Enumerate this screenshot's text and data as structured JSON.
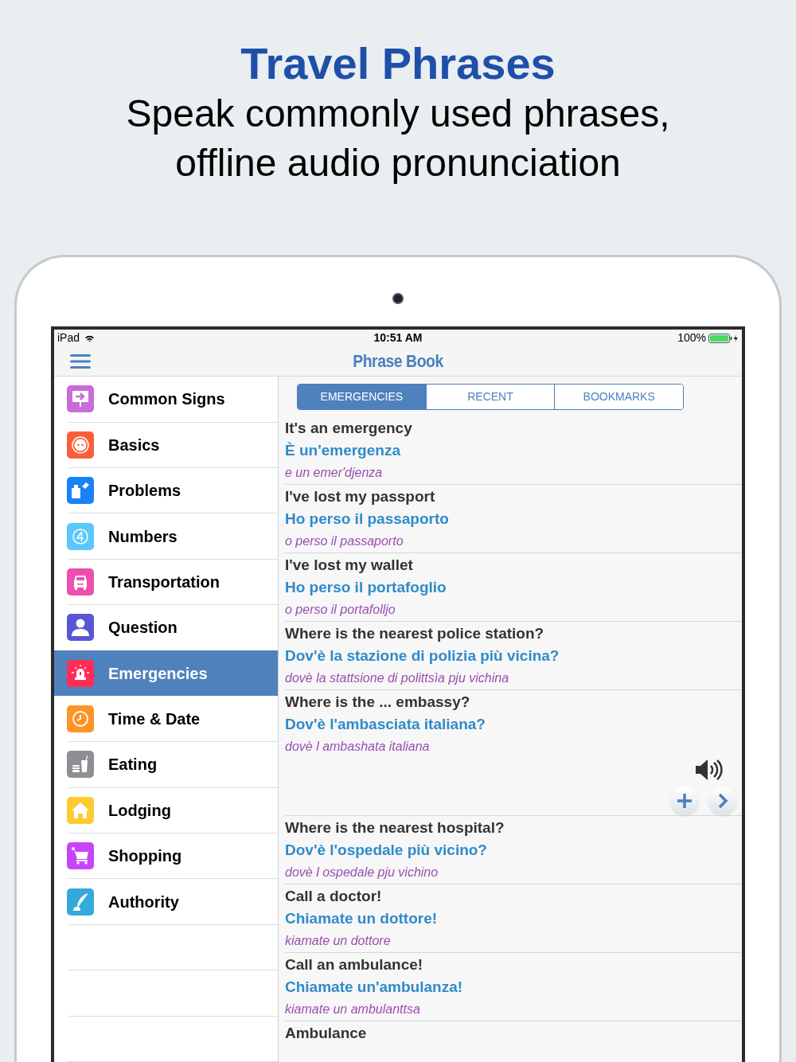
{
  "headline": {
    "title": "Travel Phrases",
    "subtitle": "Speak commonly used phrases, offline audio pronunciation"
  },
  "status_bar": {
    "device": "iPad",
    "time": "10:51 AM",
    "battery": "100%"
  },
  "nav_bar": {
    "title": "Phrase Book"
  },
  "sidebar": {
    "items": [
      {
        "label": "Common Signs",
        "color": "#c86dd7",
        "selected": false
      },
      {
        "label": "Basics",
        "color": "#fa5f3a",
        "selected": false
      },
      {
        "label": "Problems",
        "color": "#1a82f7",
        "selected": false
      },
      {
        "label": "Numbers",
        "color": "#5ac8fa",
        "selected": false
      },
      {
        "label": "Transportation",
        "color": "#ec4fae",
        "selected": false
      },
      {
        "label": "Question",
        "color": "#5856d6",
        "selected": false
      },
      {
        "label": "Emergencies",
        "color": "#ff2d55",
        "selected": true
      },
      {
        "label": "Time & Date",
        "color": "#fd9426",
        "selected": false
      },
      {
        "label": "Eating",
        "color": "#8e8e93",
        "selected": false
      },
      {
        "label": "Lodging",
        "color": "#fecb2f",
        "selected": false
      },
      {
        "label": "Shopping",
        "color": "#c644fc",
        "selected": false
      },
      {
        "label": "Authority",
        "color": "#34aadc",
        "selected": false
      }
    ]
  },
  "tabs": [
    {
      "label": "EMERGENCIES",
      "selected": true
    },
    {
      "label": "RECENT",
      "selected": false
    },
    {
      "label": "BOOKMARKS",
      "selected": false
    }
  ],
  "phrases": [
    {
      "english": "It's an emergency",
      "italian": "È un'emergenza",
      "pronunciation": "e un emer'djenza",
      "expanded": false
    },
    {
      "english": "I've lost my passport",
      "italian": "Ho perso il passaporto",
      "pronunciation": "o perso il passaporto",
      "expanded": false
    },
    {
      "english": "I've lost my wallet",
      "italian": "Ho perso il portafoglio",
      "pronunciation": "o perso il portafolljo",
      "expanded": false
    },
    {
      "english": "Where is the nearest police station?",
      "italian": "Dov'è la stazione di polizia più vicina?",
      "pronunciation": "dovè la stattsione di polittsìa pju vichina",
      "expanded": false
    },
    {
      "english": "Where is the ... embassy?",
      "italian": "Dov'è l'ambasciata italiana?",
      "pronunciation": "dovè l ambashata italiana",
      "expanded": true
    },
    {
      "english": "Where is the nearest hospital?",
      "italian": "Dov'è l'ospedale più vicino?",
      "pronunciation": "dovè l ospedale pju vichino",
      "expanded": false
    },
    {
      "english": "Call a doctor!",
      "italian": "Chiamate un dottore!",
      "pronunciation": "kiamate un dottore",
      "expanded": false
    },
    {
      "english": "Call an ambulance!",
      "italian": "Chiamate un'ambulanza!",
      "pronunciation": "kiamate un ambulanttsa",
      "expanded": false
    },
    {
      "english": "Ambulance"
    }
  ]
}
